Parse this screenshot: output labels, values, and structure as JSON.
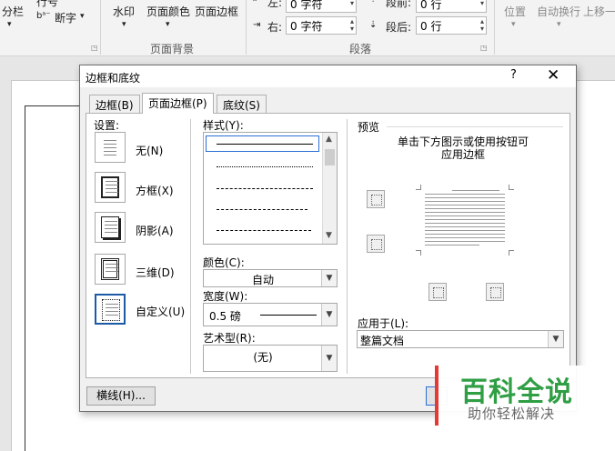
{
  "ribbon": {
    "columns_label": "分栏",
    "line_numbers_label": "行号",
    "hyphenation_label": "断字",
    "watermark_label": "水印",
    "page_color_label": "页面颜色",
    "page_borders_label": "页面边框",
    "page_background_group": "页面背景",
    "indent_left_label": "左:",
    "indent_left_value": "0 字符",
    "indent_right_label": "右:",
    "indent_right_value": "0 字符",
    "spacing_before_label": "段前:",
    "spacing_before_value": "0 行",
    "spacing_after_label": "段后:",
    "spacing_after_value": "0 行",
    "paragraph_group": "段落",
    "position_label": "位置",
    "wrap_text_label": "自动换行",
    "bring_forward_label": "上移一"
  },
  "dialog": {
    "title": "边框和底纹",
    "help": "?",
    "close": "✕",
    "tabs": [
      {
        "label": "边框(B)"
      },
      {
        "label": "页面边框(P)"
      },
      {
        "label": "底纹(S)"
      }
    ],
    "setting_label": "设置:",
    "settings": [
      {
        "label": "无(N)"
      },
      {
        "label": "方框(X)"
      },
      {
        "label": "阴影(A)"
      },
      {
        "label": "三维(D)"
      },
      {
        "label": "自定义(U)"
      }
    ],
    "style_label": "样式(Y):",
    "color_label": "颜色(C):",
    "color_value": "自动",
    "width_label": "宽度(W):",
    "width_value": "0.5 磅",
    "art_label": "艺术型(R):",
    "art_value": "(无)",
    "preview_label": "预览",
    "preview_hint_line1": "单击下方图示或使用按钮可",
    "preview_hint_line2": "应用边框",
    "apply_to_label": "应用于(L):",
    "apply_to_value": "整篇文档",
    "horizontal_line_button": "横线(H)..."
  },
  "watermark": {
    "title": "百科全说",
    "subtitle": "助你轻松解决"
  }
}
